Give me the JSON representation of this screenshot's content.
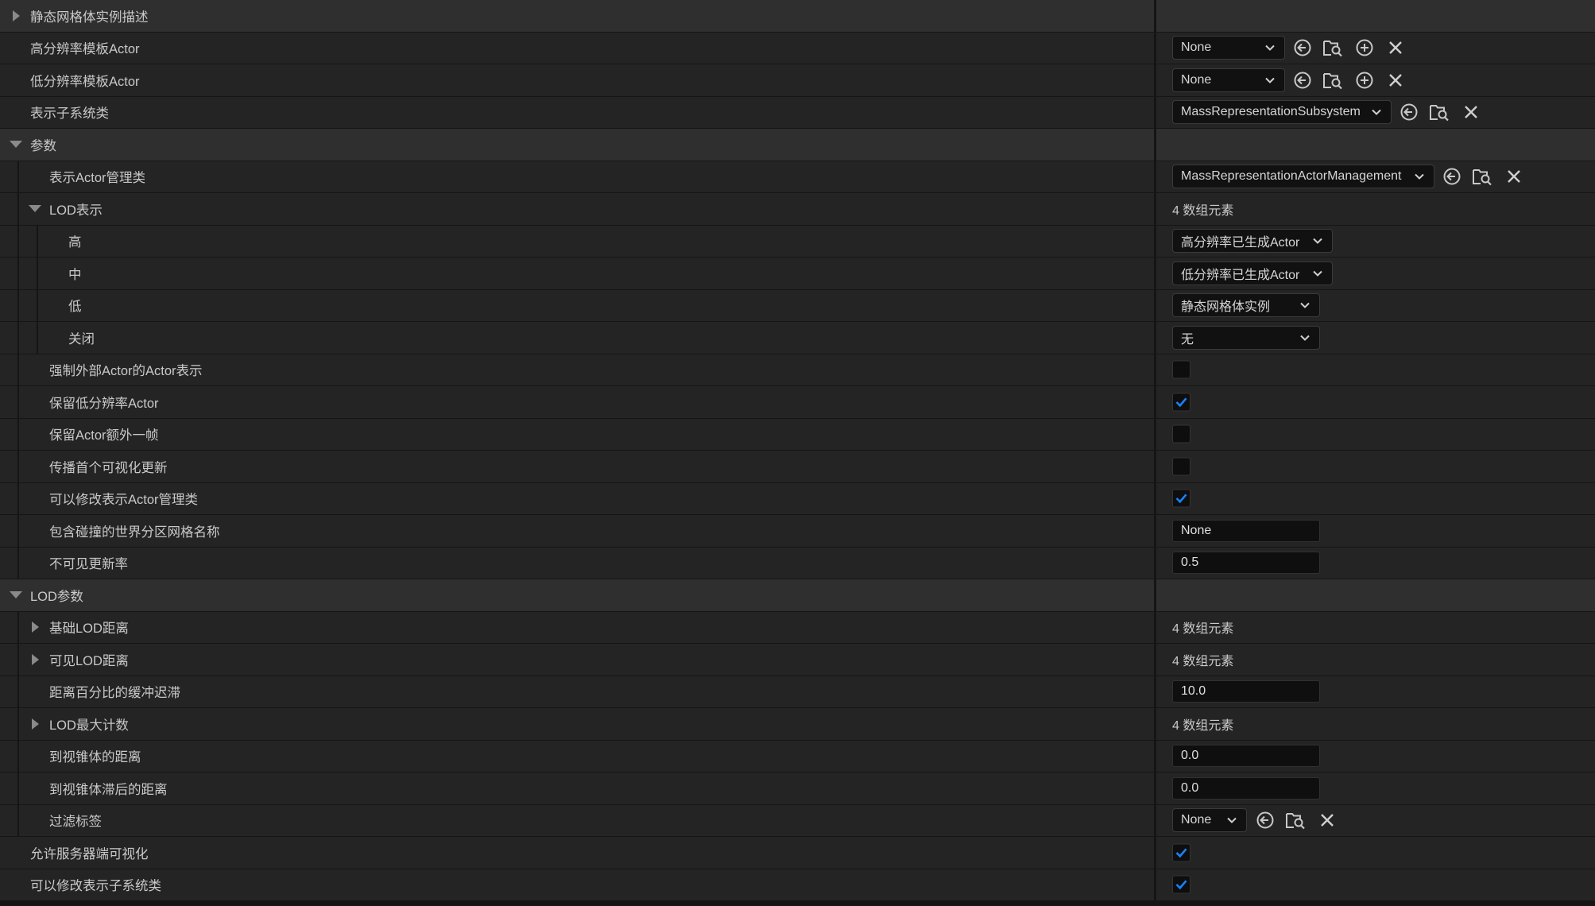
{
  "rows": [
    {
      "label": "静态网格体实例描述"
    },
    {
      "label": "高分辨率模板Actor",
      "value": "None"
    },
    {
      "label": "低分辨率模板Actor",
      "value": "None"
    },
    {
      "label": "表示子系统类",
      "value": "MassRepresentationSubsystem"
    },
    {
      "label": "参数"
    },
    {
      "label": "表示Actor管理类",
      "value": "MassRepresentationActorManagement"
    },
    {
      "label": "LOD表示",
      "value": "4 数组元素"
    },
    {
      "label": "高",
      "value": "高分辨率已生成Actor"
    },
    {
      "label": "中",
      "value": "低分辨率已生成Actor"
    },
    {
      "label": "低",
      "value": "静态网格体实例"
    },
    {
      "label": "关闭",
      "value": "无"
    },
    {
      "label": "强制外部Actor的Actor表示",
      "checked": false
    },
    {
      "label": "保留低分辨率Actor",
      "checked": true
    },
    {
      "label": "保留Actor额外一帧",
      "checked": false
    },
    {
      "label": "传播首个可视化更新",
      "checked": false
    },
    {
      "label": "可以修改表示Actor管理类",
      "checked": true
    },
    {
      "label": "包含碰撞的世界分区网格名称",
      "value": "None"
    },
    {
      "label": "不可见更新率",
      "value": "0.5"
    },
    {
      "label": "LOD参数"
    },
    {
      "label": "基础LOD距离",
      "value": "4 数组元素"
    },
    {
      "label": "可见LOD距离",
      "value": "4 数组元素"
    },
    {
      "label": "距离百分比的缓冲迟滞",
      "value": "10.0"
    },
    {
      "label": "LOD最大计数",
      "value": "4 数组元素"
    },
    {
      "label": "到视锥体的距离",
      "value": "0.0"
    },
    {
      "label": "到视锥体滞后的距离",
      "value": "0.0"
    },
    {
      "label": "过滤标签",
      "value": "None"
    },
    {
      "label": "允许服务器端可视化",
      "checked": true
    },
    {
      "label": "可以修改表示子系统类",
      "checked": true
    }
  ],
  "colors": {
    "accent": "#1a82ff",
    "background": "#242424",
    "category": "#2f2f2f"
  }
}
